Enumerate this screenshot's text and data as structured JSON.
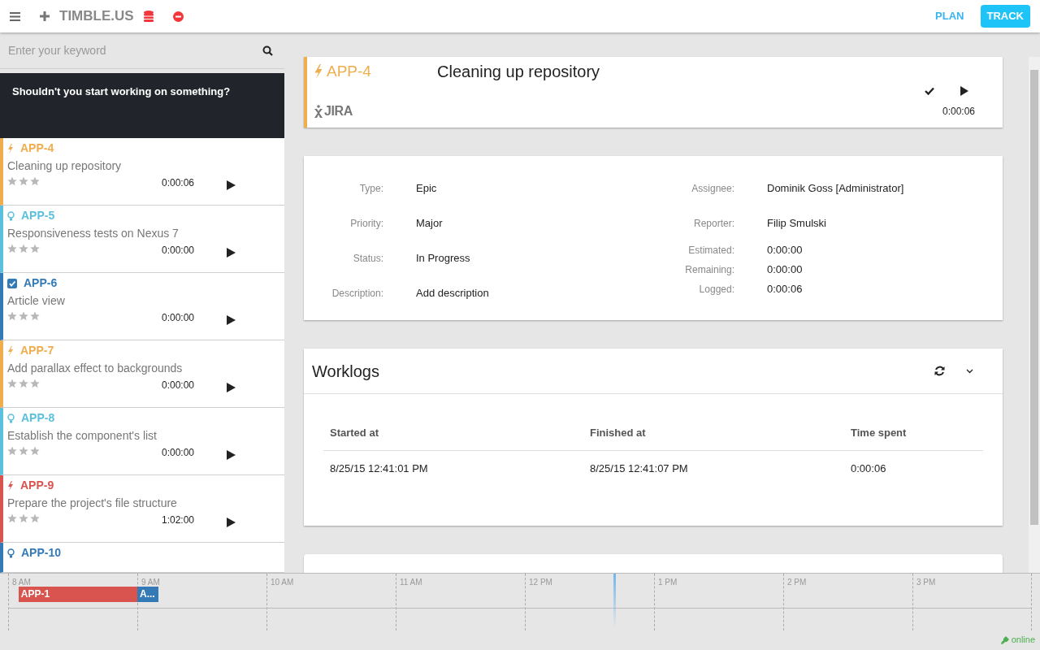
{
  "topbar": {
    "brand": "TIMBLE.US",
    "nav": [
      {
        "label": "PLAN",
        "selected": false
      },
      {
        "label": "TRACK",
        "selected": true
      }
    ]
  },
  "search": {
    "placeholder": "Enter your keyword"
  },
  "banner": "Shouldn't you start working on something?",
  "issues": [
    {
      "key": "APP-4",
      "title": "Cleaning up repository",
      "time": "0:00:06",
      "kind": "epic",
      "color": "#f0ad4e",
      "stars": 0
    },
    {
      "key": "APP-5",
      "title": "Responsiveness tests on Nexus 7",
      "time": "0:00:00",
      "kind": "story",
      "color": "#5bc0de",
      "stars": 0
    },
    {
      "key": "APP-6",
      "title": "Article view",
      "time": "0:00:00",
      "kind": "task",
      "color": "#337ab7",
      "stars": 0
    },
    {
      "key": "APP-7",
      "title": "Add parallax effect to backgrounds",
      "time": "0:00:00",
      "kind": "epic",
      "color": "#f0ad4e",
      "stars": 0
    },
    {
      "key": "APP-8",
      "title": "Establish the component's list",
      "time": "0:00:00",
      "kind": "story",
      "color": "#5bc0de",
      "stars": 0
    },
    {
      "key": "APP-9",
      "title": "Prepare the project's file structure",
      "time": "1:02:00",
      "kind": "epic",
      "color": "#d9534f",
      "stars": 0
    },
    {
      "key": "APP-10",
      "kind": "story",
      "color": "#337ab7"
    }
  ],
  "detail": {
    "key": "APP-4",
    "kind": "epic",
    "color": "#f0ad4e",
    "title": "Cleaning up repository",
    "source": "JIRA",
    "time": "0:00:06",
    "left_fields": [
      {
        "label": "Type:",
        "value": "Epic"
      },
      {
        "label": "Priority:",
        "value": "Major"
      },
      {
        "label": "Status:",
        "value": "In Progress"
      },
      {
        "label": "Description:",
        "value": "Add description"
      }
    ],
    "right_fields": [
      {
        "label": "Assignee:",
        "value": "Dominik Goss [Administrator]"
      },
      {
        "label": "Reporter:",
        "value": "Filip Smulski"
      }
    ],
    "time_fields": [
      {
        "label": "Estimated:",
        "value": "0:00:00"
      },
      {
        "label": "Remaining:",
        "value": "0:00:00"
      },
      {
        "label": "Logged:",
        "value": "0:00:06"
      }
    ]
  },
  "worklogs": {
    "title": "Worklogs",
    "columns": [
      "Started at",
      "Finished at",
      "Time spent"
    ],
    "rows": [
      [
        "8/25/15 12:41:01 PM",
        "8/25/15 12:41:07 PM",
        "0:00:06"
      ]
    ]
  },
  "timeline": {
    "hours": [
      "8 AM",
      "9 AM",
      "10 AM",
      "11 AM",
      "12 PM",
      "1 PM",
      "2 PM",
      "3 PM"
    ],
    "bars": [
      {
        "label": "APP-1",
        "color": "#d9534f"
      },
      {
        "label": "A...",
        "color": "#337ab7"
      }
    ]
  },
  "status": "online"
}
